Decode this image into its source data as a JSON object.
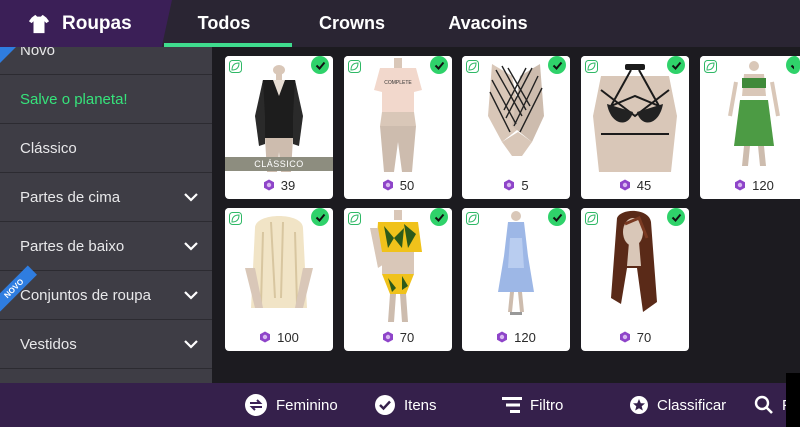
{
  "header": {
    "title": "Roupas",
    "tabs": [
      {
        "label": "Todos",
        "active": true
      },
      {
        "label": "Crowns",
        "active": false
      },
      {
        "label": "Avacoins",
        "active": false
      }
    ]
  },
  "sidebar": {
    "items": [
      {
        "label": "Novo"
      },
      {
        "label": "Salve o planeta!"
      },
      {
        "label": "Clássico"
      },
      {
        "label": "Partes de cima"
      },
      {
        "label": "Partes de baixo"
      },
      {
        "label": "Conjuntos de roupa"
      },
      {
        "label": "Vestidos"
      }
    ],
    "novo_badge": "NOVO"
  },
  "items": [
    {
      "price": "39",
      "ribbon": "CLÁSSICO"
    },
    {
      "price": "50"
    },
    {
      "price": "5"
    },
    {
      "price": "45"
    },
    {
      "price": "120"
    },
    {
      "price": "100"
    },
    {
      "price": "70"
    },
    {
      "price": "120"
    },
    {
      "price": "70"
    }
  ],
  "footer": {
    "gender": "Feminino",
    "items": "Itens",
    "filter": "Filtro",
    "sort": "Classificar",
    "search_partial": "Pe"
  },
  "colors": {
    "accent_green": "#3fdc8e",
    "brand_purple": "#3b1f57",
    "coin_purple": "#8e44c9",
    "check_green": "#2fd26a"
  }
}
